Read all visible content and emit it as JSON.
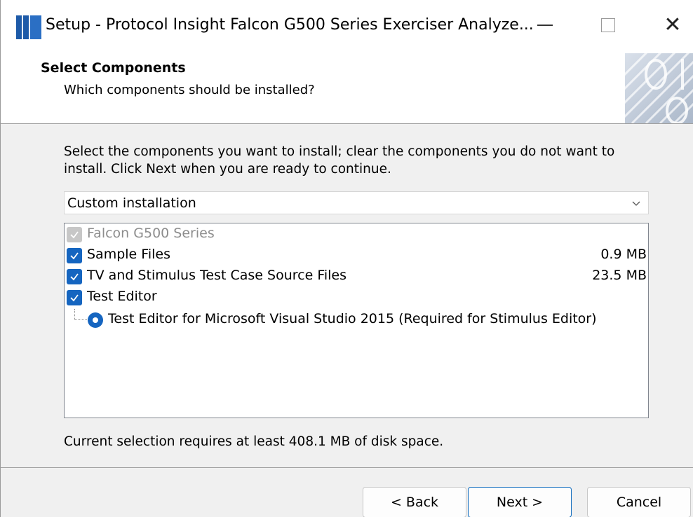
{
  "window": {
    "title": "Setup - Protocol Insight Falcon G500 Series Exerciser Analyze...",
    "accent_color": "#1d5aa8"
  },
  "header": {
    "title": "Select Components",
    "subtitle": "Which components should be installed?"
  },
  "main": {
    "instructions": "Select the components you want to install; clear the components you do not want to install. Click Next when you are ready to continue.",
    "install_type": "Custom installation",
    "components": [
      {
        "label": "Falcon G500 Series",
        "size": "",
        "checked": true,
        "disabled": true
      },
      {
        "label": "Sample Files",
        "size": "0.9 MB",
        "checked": true,
        "disabled": false
      },
      {
        "label": "TV and Stimulus Test Case Source Files",
        "size": "23.5 MB",
        "checked": true,
        "disabled": false
      },
      {
        "label": "Test Editor",
        "size": "",
        "checked": true,
        "disabled": false
      },
      {
        "label": "Test Editor for Microsoft Visual Studio 2015 (Required for Stimulus Editor)",
        "size": "",
        "selected": true,
        "type": "radio"
      }
    ],
    "disk_space": "Current selection requires at least 408.1 MB of disk space."
  },
  "buttons": {
    "back": "< Back",
    "next": "Next >",
    "cancel": "Cancel"
  },
  "colors": {
    "checkbox": "#1565c0",
    "checkbox_disabled": "#c7c7c7",
    "focus_border": "#0f6cbd"
  }
}
